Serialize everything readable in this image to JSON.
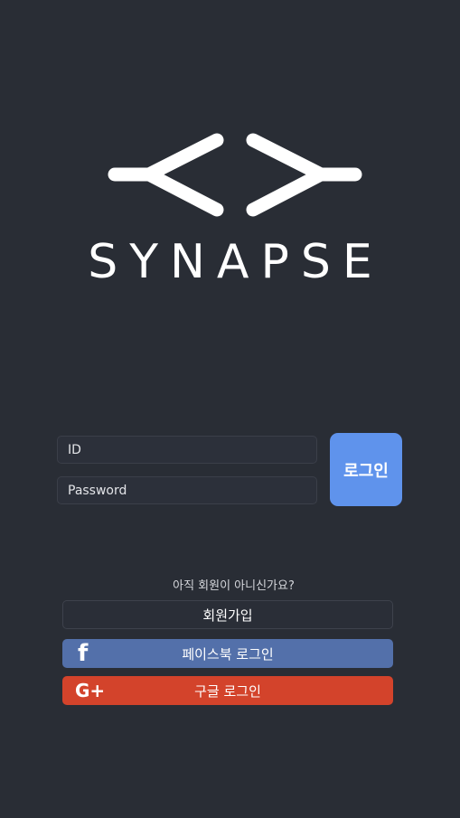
{
  "logo": {
    "wordmark": "SYNAPSE"
  },
  "login": {
    "id_placeholder": "ID",
    "password_placeholder": "Password",
    "login_label": "로그인"
  },
  "signup": {
    "prompt": "아직 회원이 아니신가요?",
    "button_label": "회원가입"
  },
  "social": {
    "facebook_label": "페이스북 로그인",
    "facebook_icon": "f",
    "google_label": "구글 로그인",
    "google_icon": "G+"
  },
  "colors": {
    "background": "#292d35",
    "login_button": "#5f93ec",
    "facebook": "#5370aa",
    "google": "#d3432b"
  }
}
